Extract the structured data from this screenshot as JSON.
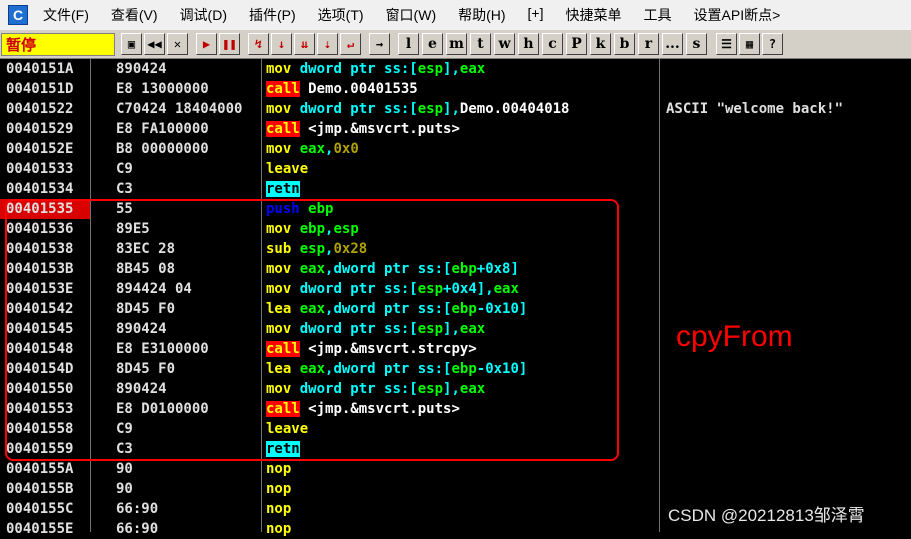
{
  "menu": {
    "app_icon": "C",
    "items": [
      "文件(F)",
      "查看(V)",
      "调试(D)",
      "插件(P)",
      "选项(T)",
      "窗口(W)",
      "帮助(H)",
      "[+]",
      "快捷菜单",
      "工具",
      "设置API断点>"
    ]
  },
  "toolbar": {
    "status": "暂停",
    "buttons1": [
      "open-icon",
      "rewind-icon",
      "close-icon"
    ],
    "buttons1_glyphs": [
      "▣",
      "◀◀",
      "✕"
    ],
    "buttons2": [
      "run-icon",
      "pause-icon"
    ],
    "buttons2_glyphs": [
      "▶",
      "❚❚"
    ],
    "buttons3": [
      "step-into-icon",
      "step-over-icon",
      "trace-into-icon",
      "trace-over-icon",
      "execute-till-return-icon"
    ],
    "buttons3_glyphs": [
      "↯",
      "↓",
      "⇊",
      "⇣",
      "↵"
    ],
    "buttons4": [
      "goto-icon"
    ],
    "buttons4_glyphs": [
      "→"
    ],
    "letters": [
      "l",
      "e",
      "m",
      "t",
      "w",
      "h",
      "c",
      "P",
      "k",
      "b",
      "r",
      "...",
      "s"
    ],
    "buttons5": [
      "list-icon",
      "grid-icon",
      "help-icon"
    ],
    "buttons5_glyphs": [
      "☰",
      "▦",
      "?"
    ]
  },
  "rows": [
    {
      "addr": "0040151A",
      "hex": "890424",
      "mn": "mov",
      "mt": "normal",
      "ops": [
        [
          "dword ptr ss:[",
          "kw"
        ],
        [
          "esp",
          "reg"
        ],
        [
          "],",
          "kw"
        ],
        [
          "eax",
          "reg"
        ]
      ],
      "cmt": ""
    },
    {
      "addr": "0040151D",
      "hex": "E8 13000000",
      "mn": "call",
      "mt": "call",
      "ops": [
        [
          "Demo.00401535",
          "plain"
        ]
      ],
      "cmt": ""
    },
    {
      "addr": "00401522",
      "hex": "C70424 18404000",
      "mn": "mov",
      "mt": "normal",
      "ops": [
        [
          "dword ptr ss:[",
          "kw"
        ],
        [
          "esp",
          "reg"
        ],
        [
          "],",
          "kw"
        ],
        [
          "Demo.00404018",
          "plain"
        ]
      ],
      "cmt": "ASCII \"welcome back!\""
    },
    {
      "addr": "00401529",
      "hex": "E8 FA100000",
      "mn": "call",
      "mt": "call",
      "ops": [
        [
          "<jmp.&msvcrt.puts>",
          "plain"
        ]
      ],
      "cmt": ""
    },
    {
      "addr": "0040152E",
      "hex": "B8 00000000",
      "mn": "mov",
      "mt": "normal",
      "ops": [
        [
          "eax",
          "reg"
        ],
        [
          ",",
          "kw"
        ],
        [
          "0x0",
          "num"
        ]
      ],
      "cmt": ""
    },
    {
      "addr": "00401533",
      "hex": "C9",
      "mn": "leave",
      "mt": "normal",
      "ops": [],
      "cmt": ""
    },
    {
      "addr": "00401534",
      "hex": "C3",
      "mn": "retn",
      "mt": "retn",
      "ops": [],
      "cmt": ""
    },
    {
      "addr": "00401535",
      "hex": "55",
      "mn": "push",
      "mt": "push",
      "ops": [
        [
          "ebp",
          "reg"
        ]
      ],
      "cmt": "",
      "hl": true
    },
    {
      "addr": "00401536",
      "hex": "89E5",
      "mn": "mov",
      "mt": "normal",
      "ops": [
        [
          "ebp",
          "reg"
        ],
        [
          ",",
          "kw"
        ],
        [
          "esp",
          "reg"
        ]
      ],
      "cmt": ""
    },
    {
      "addr": "00401538",
      "hex": "83EC 28",
      "mn": "sub",
      "mt": "normal",
      "ops": [
        [
          "esp",
          "reg"
        ],
        [
          ",",
          "kw"
        ],
        [
          "0x28",
          "num"
        ]
      ],
      "cmt": ""
    },
    {
      "addr": "0040153B",
      "hex": "8B45 08",
      "mn": "mov",
      "mt": "normal",
      "ops": [
        [
          "eax",
          "reg"
        ],
        [
          ",dword ptr ss:[",
          "kw"
        ],
        [
          "ebp",
          "reg"
        ],
        [
          "+0x8]",
          "kw"
        ]
      ],
      "cmt": ""
    },
    {
      "addr": "0040153E",
      "hex": "894424 04",
      "mn": "mov",
      "mt": "normal",
      "ops": [
        [
          "dword ptr ss:[",
          "kw"
        ],
        [
          "esp",
          "reg"
        ],
        [
          "+0x4],",
          "kw"
        ],
        [
          "eax",
          "reg"
        ]
      ],
      "cmt": ""
    },
    {
      "addr": "00401542",
      "hex": "8D45 F0",
      "mn": "lea",
      "mt": "normal",
      "ops": [
        [
          "eax",
          "reg"
        ],
        [
          ",dword ptr ss:[",
          "kw"
        ],
        [
          "ebp",
          "reg"
        ],
        [
          "-0x10]",
          "kw"
        ]
      ],
      "cmt": ""
    },
    {
      "addr": "00401545",
      "hex": "890424",
      "mn": "mov",
      "mt": "normal",
      "ops": [
        [
          "dword ptr ss:[",
          "kw"
        ],
        [
          "esp",
          "reg"
        ],
        [
          "],",
          "kw"
        ],
        [
          "eax",
          "reg"
        ]
      ],
      "cmt": ""
    },
    {
      "addr": "00401548",
      "hex": "E8 E3100000",
      "mn": "call",
      "mt": "call",
      "ops": [
        [
          "<jmp.&msvcrt.strcpy>",
          "plain"
        ]
      ],
      "cmt": ""
    },
    {
      "addr": "0040154D",
      "hex": "8D45 F0",
      "mn": "lea",
      "mt": "normal",
      "ops": [
        [
          "eax",
          "reg"
        ],
        [
          ",dword ptr ss:[",
          "kw"
        ],
        [
          "ebp",
          "reg"
        ],
        [
          "-0x10]",
          "kw"
        ]
      ],
      "cmt": ""
    },
    {
      "addr": "00401550",
      "hex": "890424",
      "mn": "mov",
      "mt": "normal",
      "ops": [
        [
          "dword ptr ss:[",
          "kw"
        ],
        [
          "esp",
          "reg"
        ],
        [
          "],",
          "kw"
        ],
        [
          "eax",
          "reg"
        ]
      ],
      "cmt": ""
    },
    {
      "addr": "00401553",
      "hex": "E8 D0100000",
      "mn": "call",
      "mt": "call",
      "ops": [
        [
          "<jmp.&msvcrt.puts>",
          "plain"
        ]
      ],
      "cmt": ""
    },
    {
      "addr": "00401558",
      "hex": "C9",
      "mn": "leave",
      "mt": "normal",
      "ops": [],
      "cmt": ""
    },
    {
      "addr": "00401559",
      "hex": "C3",
      "mn": "retn",
      "mt": "retn",
      "ops": [],
      "cmt": ""
    },
    {
      "addr": "0040155A",
      "hex": "90",
      "mn": "nop",
      "mt": "normal",
      "ops": [],
      "cmt": ""
    },
    {
      "addr": "0040155B",
      "hex": "90",
      "mn": "nop",
      "mt": "normal",
      "ops": [],
      "cmt": ""
    },
    {
      "addr": "0040155C",
      "hex": "66:90",
      "mn": "nop",
      "mt": "normal",
      "ops": [],
      "cmt": ""
    },
    {
      "addr": "0040155E",
      "hex": "66:90",
      "mn": "nop",
      "mt": "normal",
      "ops": [],
      "cmt": ""
    }
  ],
  "annotation": {
    "label": "cpyFrom",
    "color": "#ff0000"
  },
  "watermark": "CSDN @20212813邹泽霄"
}
